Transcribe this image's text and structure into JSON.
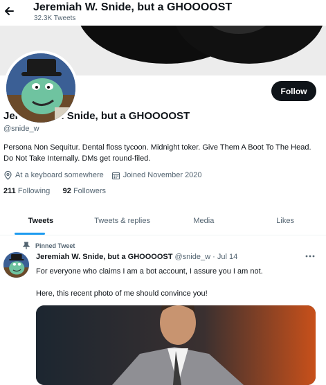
{
  "header": {
    "title": "Jeremiah W. Snide, but a GHOOOOST",
    "tweet_count": "32.3K Tweets",
    "back_icon": "arrow-left-icon"
  },
  "profile": {
    "display_name": "Jeremiah W. Snide, but a GHOOOOST",
    "handle": "@snide_w",
    "follow_label": "Follow",
    "bio": "Persona Non Sequitur. Dental floss tycoon. Midnight toker. Give Them A Boot To The Head. Do Not Take Internally. DMs get round-filed.",
    "location": "At a keyboard somewhere",
    "joined": "Joined November 2020",
    "following_count": "211",
    "following_label": "Following",
    "followers_count": "92",
    "followers_label": "Followers"
  },
  "tabs": [
    {
      "label": "Tweets"
    },
    {
      "label": "Tweets & replies"
    },
    {
      "label": "Media"
    },
    {
      "label": "Likes"
    }
  ],
  "pinned_tweet": {
    "pinned_label": "Pinned Tweet",
    "author_name": "Jeremiah W. Snide, but a GHOOOOST",
    "author_handle": "@snide_w",
    "separator": "·",
    "date": "Jul 14",
    "text_line1": "For everyone who claims I am a bot account, I assure you I am not.",
    "text_line2": "Here, this recent photo of me should convince you!"
  },
  "colors": {
    "accent": "#1d9bf0",
    "text_primary": "#0f1419",
    "text_secondary": "#536471",
    "follow_bg": "#0f1419"
  }
}
